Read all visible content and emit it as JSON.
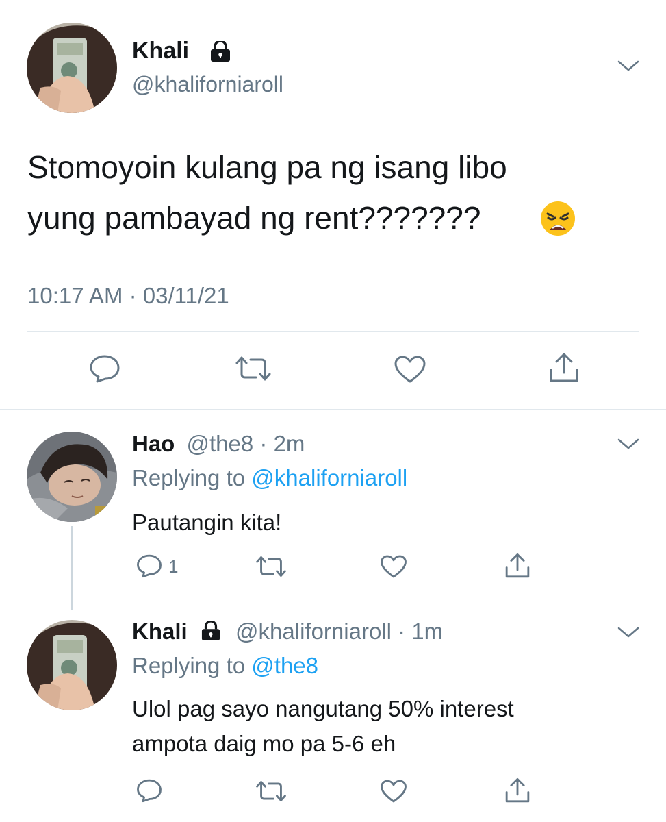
{
  "main_tweet": {
    "author_name": "Khali",
    "author_handle": "@khaliforniaroll",
    "text_line1": "Stomoyoin kulang pa ng isang libo",
    "text_line2": "yung pambayad ng rent???????",
    "emoji": "😩",
    "timestamp": "10:17 AM · 03/11/21"
  },
  "replies": [
    {
      "author_name": "Hao",
      "author_handle": "@the8",
      "time": "· 2m",
      "replying_prefix": "Replying to",
      "replying_to": "@khaliforniaroll",
      "text_lines": [
        "Pautangin kita!"
      ],
      "reply_count": "1"
    },
    {
      "author_name": "Khali",
      "author_handle": "@khaliforniaroll",
      "time": "· 1m",
      "replying_prefix": "Replying to",
      "replying_to": "@the8",
      "text_lines": [
        "Ulol pag sayo nangutang 50% interest",
        "ampota daig mo pa 5-6 eh"
      ],
      "reply_count": ""
    }
  ],
  "icons": {
    "lock": "lock-icon",
    "chevron": "chevron-down-icon",
    "reply": "reply-icon",
    "retweet": "retweet-icon",
    "like": "heart-icon",
    "share": "share-icon"
  },
  "colors": {
    "link": "#1da1f2",
    "muted": "#657786",
    "icon": "#657786",
    "divider": "#e1e8ed"
  }
}
